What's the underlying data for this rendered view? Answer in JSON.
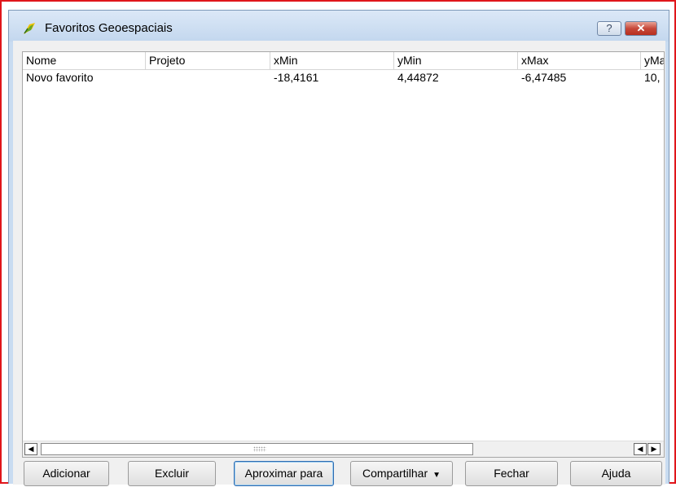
{
  "window": {
    "title": "Favoritos Geoespaciais",
    "help_label": "?",
    "close_label": "✕"
  },
  "table": {
    "columns": [
      "Nome",
      "Projeto",
      "xMin",
      "yMin",
      "xMax",
      "yMa"
    ],
    "rows": [
      [
        "Novo favorito",
        "",
        "-18,4161",
        "4,44872",
        "-6,47485",
        "10,"
      ]
    ]
  },
  "scrollbar": {
    "left_arrow": "◀",
    "right_arrow": "▶"
  },
  "buttons": {
    "add": "Adicionar",
    "delete": "Excluir",
    "zoom_to": "Aproximar para",
    "share": "Compartilhar",
    "share_caret": "▼",
    "close": "Fechar",
    "help": "Ajuda"
  },
  "colors": {
    "frame_border": "#e0161b",
    "title_bg": "#c9dcf1",
    "close_btn": "#c7483a"
  }
}
